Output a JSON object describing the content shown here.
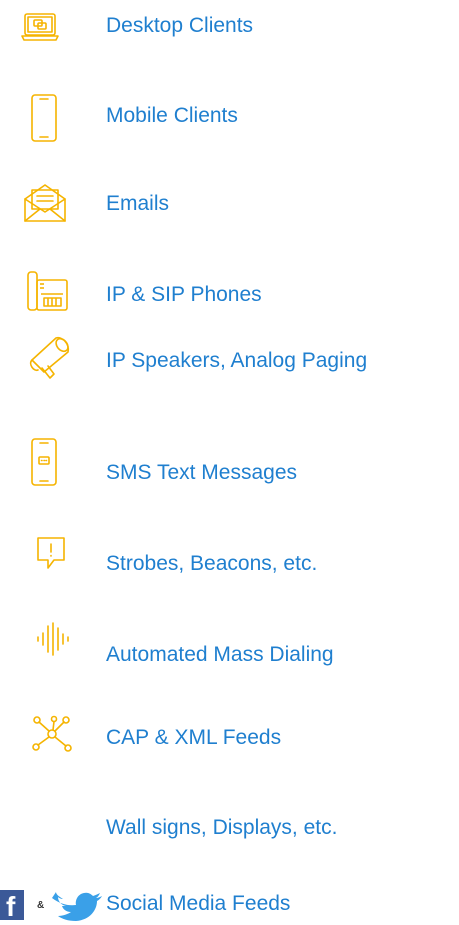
{
  "colors": {
    "icon_accent": "#f5b400",
    "link_text": "#1f7fcf",
    "facebook_blue": "#3b5998",
    "twitter_blue": "#3aa0e8"
  },
  "channels": [
    {
      "label": "Desktop Clients",
      "icon": "desktop-monitor-icon"
    },
    {
      "label": "Mobile Clients",
      "icon": "mobile-phone-icon"
    },
    {
      "label": "Emails",
      "icon": "envelope-icon"
    },
    {
      "label": "IP & SIP Phones",
      "icon": "desk-phone-icon"
    },
    {
      "label": "IP Speakers, Analog Paging",
      "icon": "megaphone-icon"
    },
    {
      "label": "SMS Text Messages",
      "icon": "sms-phone-icon"
    },
    {
      "label": "Strobes, Beacons, etc.",
      "icon": "alert-beacon-icon"
    },
    {
      "label": "Automated Mass Dialing",
      "icon": "audio-wave-icon"
    },
    {
      "label": "CAP & XML Feeds",
      "icon": "network-nodes-icon"
    },
    {
      "label": "Wall signs, Displays, etc.",
      "icon": ""
    },
    {
      "label": "Social Media Feeds",
      "icon": "facebook-twitter-icons"
    }
  ],
  "social": {
    "facebook_letter": "f",
    "ampersand": "&"
  }
}
